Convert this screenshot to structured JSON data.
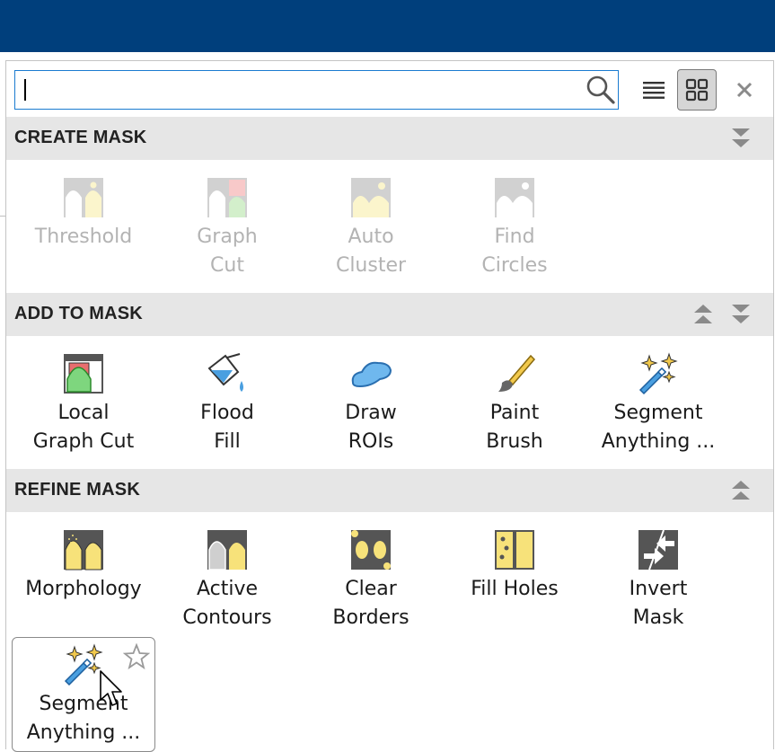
{
  "search": {
    "value": "",
    "placeholder": ""
  },
  "toolbar": {
    "list_view_icon": "list-view-icon",
    "grid_view_icon": "grid-view-icon",
    "close_icon": "close-icon"
  },
  "sections": [
    {
      "title": "CREATE MASK",
      "tools": [
        {
          "label": "Threshold",
          "icon": "threshold-icon",
          "enabled": false
        },
        {
          "label": "Graph\nCut",
          "icon": "graph-cut-icon",
          "enabled": false
        },
        {
          "label": "Auto\nCluster",
          "icon": "auto-cluster-icon",
          "enabled": false
        },
        {
          "label": "Find\nCircles",
          "icon": "find-circles-icon",
          "enabled": false
        }
      ]
    },
    {
      "title": "ADD TO MASK",
      "tools": [
        {
          "label": "Local\nGraph Cut",
          "icon": "local-graph-cut-icon",
          "enabled": true
        },
        {
          "label": "Flood\nFill",
          "icon": "flood-fill-icon",
          "enabled": true
        },
        {
          "label": "Draw\nROIs",
          "icon": "draw-rois-icon",
          "enabled": true
        },
        {
          "label": "Paint\nBrush",
          "icon": "paint-brush-icon",
          "enabled": true
        },
        {
          "label": "Segment\nAnything ...",
          "icon": "segment-anything-icon",
          "enabled": true
        }
      ]
    },
    {
      "title": "REFINE MASK",
      "tools": [
        {
          "label": "Morphology",
          "icon": "morphology-icon",
          "enabled": true
        },
        {
          "label": "Active\nContours",
          "icon": "active-contours-icon",
          "enabled": true
        },
        {
          "label": "Clear\nBorders",
          "icon": "clear-borders-icon",
          "enabled": true
        },
        {
          "label": "Fill Holes",
          "icon": "fill-holes-icon",
          "enabled": true
        },
        {
          "label": "Invert\nMask",
          "icon": "invert-mask-icon",
          "enabled": true
        },
        {
          "label": "Segment\nAnything ...",
          "icon": "segment-anything-icon",
          "enabled": true,
          "hovered": true
        }
      ]
    }
  ]
}
